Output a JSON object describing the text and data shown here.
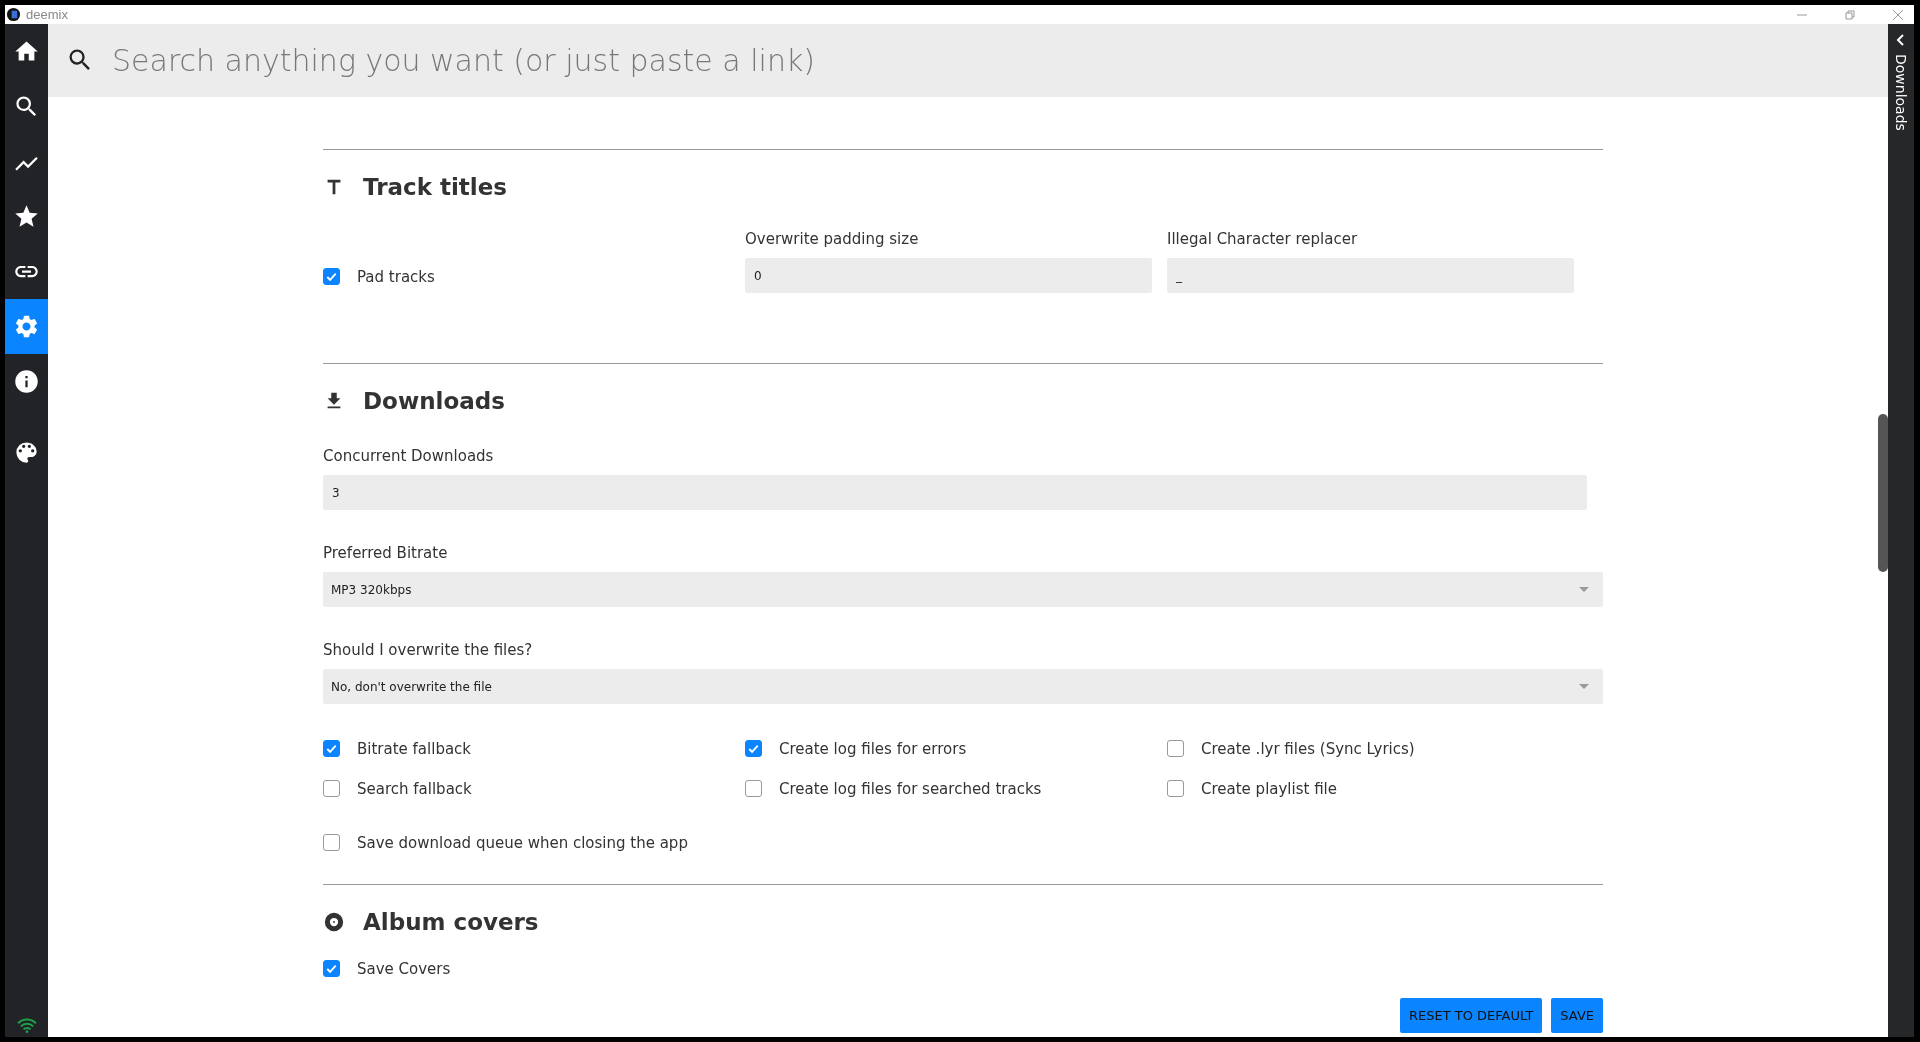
{
  "window": {
    "title": "deemix"
  },
  "sidebar": {
    "items": [
      {
        "selected": false
      },
      {
        "selected": false
      },
      {
        "selected": false
      },
      {
        "selected": false
      },
      {
        "selected": false
      },
      {
        "selected": true
      },
      {
        "selected": false
      },
      {
        "selected": false
      }
    ]
  },
  "search": {
    "placeholder": "Search anything you want (or just paste a link)"
  },
  "downloads_panel": {
    "label": "Downloads"
  },
  "track_titles": {
    "title": "Track titles",
    "pad_tracks": {
      "label": "Pad tracks",
      "checked": true
    },
    "fields": [
      {
        "label": "Overwrite padding size",
        "value": "0"
      },
      {
        "label": "Illegal Character replacer",
        "value": "_"
      }
    ]
  },
  "downloads": {
    "title": "Downloads",
    "concurrent": {
      "label": "Concurrent Downloads",
      "value": "3"
    },
    "selects": [
      {
        "label": "Preferred Bitrate",
        "value": "MP3 320kbps"
      },
      {
        "label": "Should I overwrite the files?",
        "value": "No, don't overwrite the file"
      }
    ],
    "checkboxes": [
      {
        "label": "Bitrate fallback",
        "checked": true
      },
      {
        "label": "Create log files for errors",
        "checked": true
      },
      {
        "label": "Create .lyr files (Sync Lyrics)",
        "checked": false
      },
      {
        "label": "Search fallback",
        "checked": false
      },
      {
        "label": "Create log files for searched tracks",
        "checked": false
      },
      {
        "label": "Create playlist file",
        "checked": false
      }
    ],
    "save_queue": {
      "label": "Save download queue when closing the app",
      "checked": false
    }
  },
  "album_covers": {
    "title": "Album covers",
    "checkboxes": [
      {
        "label": "Save Covers",
        "checked": true
      }
    ]
  },
  "buttons": [
    {
      "label": "RESET TO DEFAULT"
    },
    {
      "label": "SAVE"
    }
  ]
}
